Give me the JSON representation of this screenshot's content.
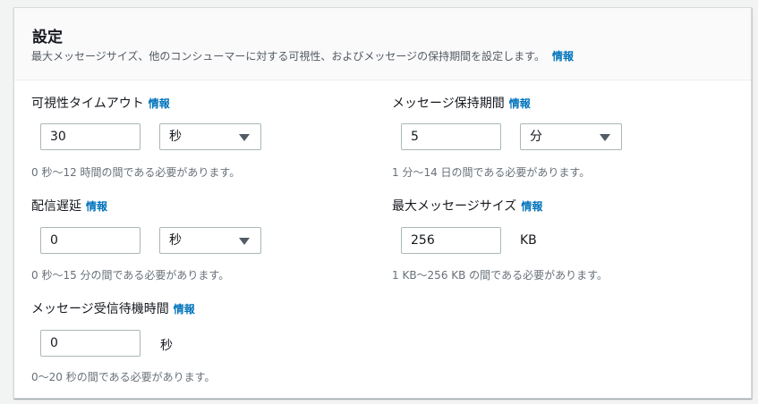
{
  "section": {
    "title": "設定",
    "description": "最大メッセージサイズ、他のコンシューマーに対する可視性、およびメッセージの保持期間を設定します。",
    "info_label": "情報"
  },
  "fields": {
    "visibility_timeout": {
      "label": "可視性タイムアウト",
      "info": "情報",
      "value": "30",
      "unit": "秒",
      "hint": "0 秒〜12 時間の間である必要があります。"
    },
    "retention_period": {
      "label": "メッセージ保持期間",
      "info": "情報",
      "value": "5",
      "unit": "分",
      "hint": "1 分〜14 日の間である必要があります。"
    },
    "delivery_delay": {
      "label": "配信遅延",
      "info": "情報",
      "value": "0",
      "unit": "秒",
      "hint": "0 秒〜15 分の間である必要があります。"
    },
    "max_message_size": {
      "label": "最大メッセージサイズ",
      "info": "情報",
      "value": "256",
      "unit": "KB",
      "hint": "1 KB〜256 KB の間である必要があります。"
    },
    "receive_wait_time": {
      "label": "メッセージ受信待機時間",
      "info": "情報",
      "value": "0",
      "unit": "秒",
      "hint": "0〜20 秒の間である必要があります。"
    }
  },
  "colors": {
    "link": "#0073bb",
    "text": "#16191f",
    "hint": "#687078",
    "border": "#aab7b8"
  }
}
